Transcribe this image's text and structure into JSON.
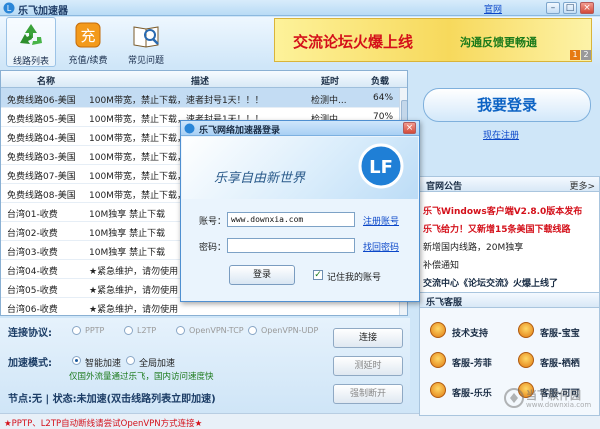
{
  "window": {
    "title": "乐飞加速器",
    "official_link": "官网",
    "min": "–",
    "max": "□",
    "close": "×"
  },
  "toolbar": {
    "items": [
      {
        "label": "线路列表",
        "icon": "recycle-icon"
      },
      {
        "label": "充值/续费",
        "icon": "recharge-icon"
      },
      {
        "label": "常见问题",
        "icon": "faq-book-icon"
      }
    ]
  },
  "banner": {
    "text_main": "交流论坛火爆上线",
    "text_sub": "沟通反馈更畅通",
    "page1": "1",
    "page2": "2"
  },
  "server_table": {
    "columns": [
      "名称",
      "描述",
      "延时",
      "负载"
    ],
    "rows": [
      [
        "免费线路06-美国",
        "100M带宽，禁止下载，速者封号1天！！！",
        "检测中...",
        "64%"
      ],
      [
        "免费线路05-美国",
        "100M带宽，禁止下载，速者封号1天！！！",
        "检测中...",
        "70%"
      ],
      [
        "免费线路04-美国",
        "100M带宽，禁止下载，",
        "",
        ""
      ],
      [
        "免费线路03-美国",
        "100M带宽，禁止下载，",
        "",
        ""
      ],
      [
        "免费线路07-美国",
        "100M带宽，禁止下载，",
        "",
        ""
      ],
      [
        "免费线路08-美国",
        "100M带宽，禁止下载，",
        "",
        ""
      ],
      [
        "台湾01-收费",
        "10M独享 禁止下载",
        "",
        ""
      ],
      [
        "台湾02-收费",
        "10M独享 禁止下载",
        "",
        ""
      ],
      [
        "台湾03-收费",
        "10M独享 禁止下载",
        "",
        ""
      ],
      [
        "台湾04-收费",
        "★紧急维护，请勿使用",
        "",
        ""
      ],
      [
        "台湾05-收费",
        "★紧急维护，请勿使用",
        "",
        ""
      ],
      [
        "台湾06-收费",
        "★紧急维护，请勿使用",
        "",
        ""
      ]
    ]
  },
  "connection": {
    "protocol_label": "连接协议:",
    "protocols": [
      "PPTP",
      "L2TP",
      "OpenVPN-TCP",
      "OpenVPN-UDP"
    ],
    "mode_label": "加速模式:",
    "modes": [
      "智能加速",
      "全局加速"
    ],
    "mode_hint": "仅国外流量通过乐飞，国内访问速度快",
    "status_line": "节点:无 | 状态:未加速(双击线路列表立即加速)",
    "buttons": {
      "connect": "连接",
      "latency": "测延时",
      "disconnect": "强制断开"
    }
  },
  "status_bar": {
    "text": "★PPTP、L2TP自动断线请尝试OpenVPN方式连接★"
  },
  "right_panel": {
    "login_button": "我要登录",
    "register_link": "现在注册",
    "announce_header": "官网公告",
    "more": "更多>",
    "announcements": [
      {
        "text": "乐飞Windows客户端V2.8.0版本发布",
        "color": "#d4101a"
      },
      {
        "text": "乐飞给力！又新增15条美国下载线路",
        "color": "#d4101a"
      },
      {
        "text": "新增国内线路，20M独享",
        "color": "#222222"
      },
      {
        "text": "补偿通知",
        "color": "#222222"
      },
      {
        "text": "交流中心《论坛交流》火爆上线了",
        "color": "#1a2d45"
      }
    ],
    "service_header": "乐飞客服",
    "services": [
      "技术支持",
      "客服-宝宝",
      "客服-芳菲",
      "客服-栖栖",
      "客服-乐乐",
      "客服-可可"
    ]
  },
  "dialog": {
    "title": "乐飞网络加速器登录",
    "slogan": "乐享自由新世界",
    "logo_text": "LF",
    "account_label": "账号：",
    "account_value": "www.downxia.com",
    "register_link": "注册账号",
    "password_label": "密码：",
    "recover_link": "找回密码",
    "login_button": "登录",
    "remember_label": "记住我的账号",
    "remember_checked": true
  },
  "watermark": {
    "text": "当下软件园",
    "url": "www.downxia.com"
  }
}
